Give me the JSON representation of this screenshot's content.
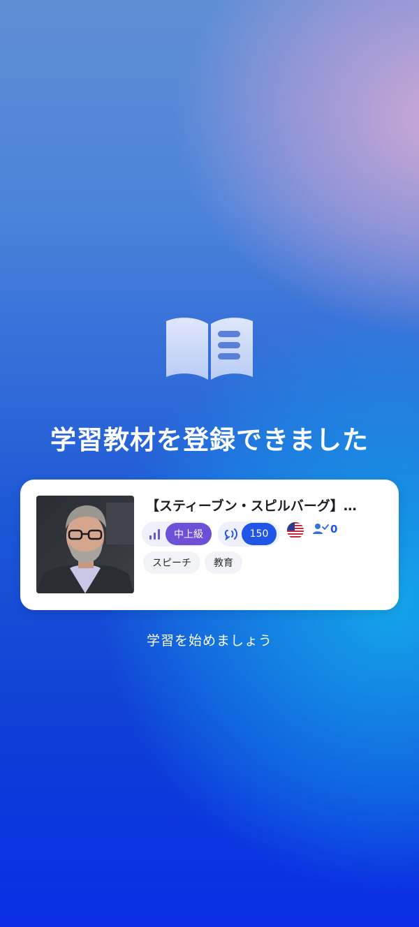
{
  "completion": {
    "headline": "学習教材を登録できました",
    "start_prompt": "学習を始めましょう"
  },
  "material_card": {
    "title": "【スティーブン・スピルバーグ】…",
    "thumbnail_icon": "portrait-photo",
    "level": "中上級",
    "level_icon": "signal-bars-icon",
    "word_count": "150",
    "word_count_icon": "speaking-icon",
    "language_flag": "us-flag-icon",
    "learners_icon": "user-check-icon",
    "learners_count": "0",
    "tags": [
      "スピーチ",
      "教育"
    ]
  },
  "colors": {
    "level_pill": "#6e4fd8",
    "words_pill": "#1f56e8",
    "accent_blue": "#1f56e8"
  }
}
